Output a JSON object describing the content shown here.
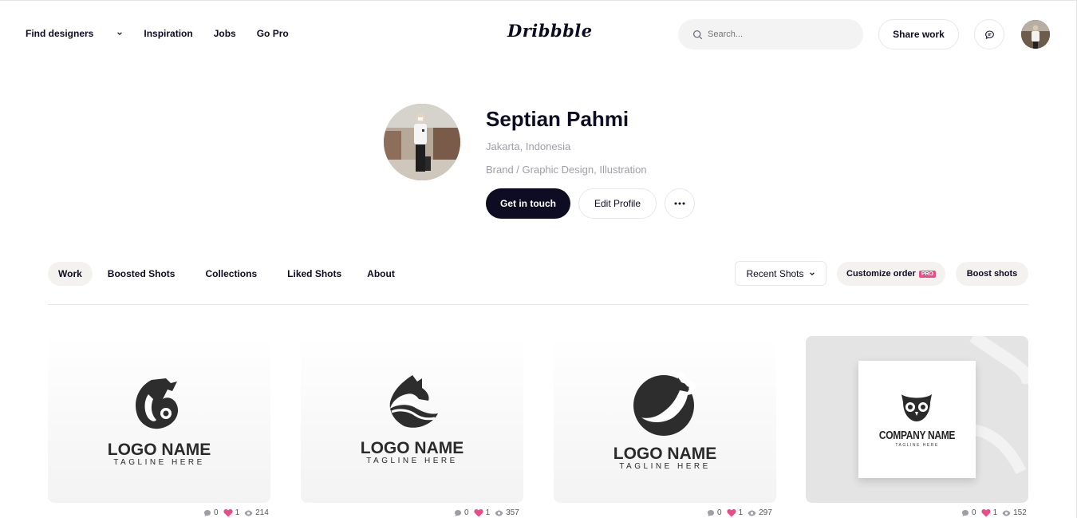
{
  "header": {
    "nav": [
      "Find designers",
      "Inspiration",
      "Jobs",
      "Go Pro"
    ],
    "logo": "Dribbble",
    "search_placeholder": "Search...",
    "share_label": "Share work"
  },
  "profile": {
    "name": "Septian Pahmi",
    "location": "Jakarta, Indonesia",
    "skills": "Brand / Graphic Design, Illustration",
    "contact_label": "Get in touch",
    "edit_label": "Edit Profile",
    "more_label": "•••"
  },
  "tabs": [
    "Work",
    "Boosted Shots",
    "Collections",
    "Liked Shots",
    "About"
  ],
  "controls": {
    "sort_label": "Recent Shots",
    "customize_label": "Customize order",
    "pro_badge": "PRO",
    "boost_label": "Boost shots"
  },
  "shots": [
    {
      "logo": "LOGO NAME",
      "tagline": "TAGLINE HERE",
      "comments": "0",
      "likes": "1",
      "views": "214"
    },
    {
      "logo": "LOGO NAME",
      "tagline": "TAGLINE HERE",
      "comments": "0",
      "likes": "1",
      "views": "357"
    },
    {
      "logo": "LOGO NAME",
      "tagline": "TAGLINE HERE",
      "comments": "0",
      "likes": "1",
      "views": "297"
    },
    {
      "logo": "COMPANY NAME",
      "tagline": "TAGLINE HERE",
      "comments": "0",
      "likes": "1",
      "views": "152"
    }
  ],
  "colors": {
    "primary": "#0d0c22",
    "accent": "#ea4c89",
    "muted": "#9e9ea7"
  }
}
